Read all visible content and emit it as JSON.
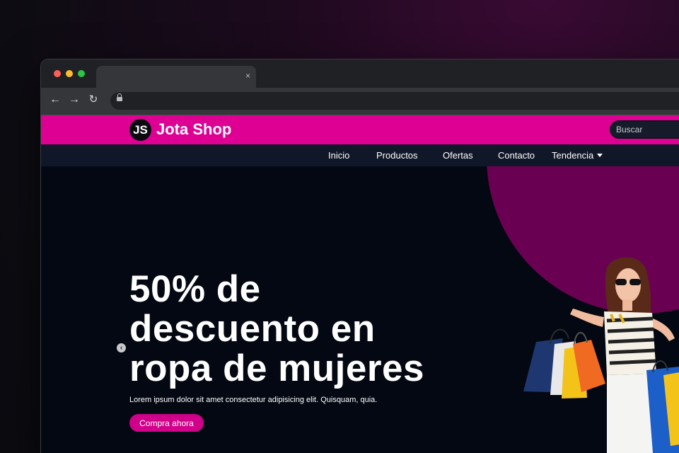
{
  "browser": {
    "tab_close_glyph": "×",
    "icons": [
      "back-arrow-icon",
      "forward-arrow-icon",
      "reload-icon",
      "lock-icon",
      "tab-close-icon"
    ]
  },
  "header": {
    "logo_initials": "JS",
    "brand_name": "Jota Shop",
    "search_placeholder": "Buscar",
    "color": "#de0093"
  },
  "nav": {
    "items": [
      {
        "label": "Inicio"
      },
      {
        "label": "Productos"
      },
      {
        "label": "Ofertas"
      },
      {
        "label": "Contacto"
      },
      {
        "label": "Tendencia"
      }
    ],
    "background": "#101728"
  },
  "hero": {
    "title": "50% de descuento en ropa de mujeres",
    "text": "Lorem ipsum dolor sit amet consectetur adipisicing elit. Quisquam, quia.",
    "cta_label": "Compra ahora",
    "accent": "#d1008a",
    "circle_color": "#6a0052",
    "prev_glyph": "‹"
  }
}
